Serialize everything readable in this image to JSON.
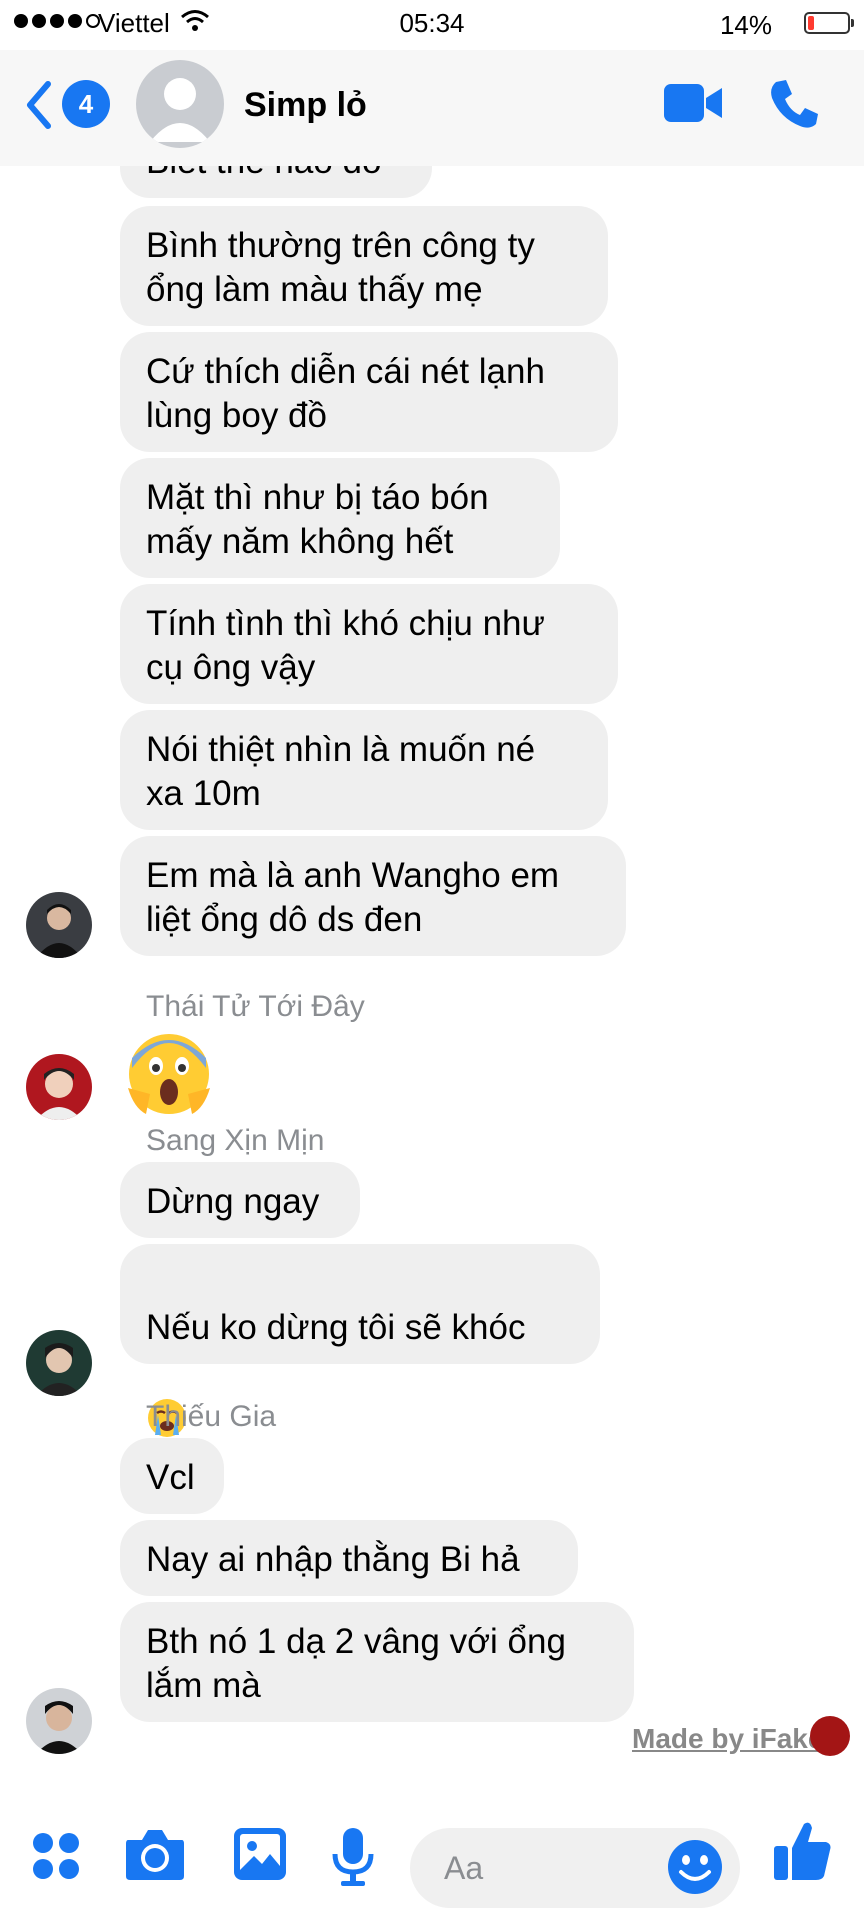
{
  "status_bar": {
    "carrier": "Viettel",
    "time": "05:34",
    "battery": "14%",
    "battery_level": 0.14
  },
  "header": {
    "back_count": "4",
    "title": "Simp lỏ",
    "icons": [
      "back-chevron-icon",
      "video-call-icon",
      "phone-call-icon"
    ]
  },
  "messages": {
    "partial_top": "Biết thế nào đó",
    "group1": [
      "Bình thường trên công ty\nổng làm màu thấy mẹ",
      "Cứ thích diễn cái nét lạnh\nlùng boy đồ",
      "Mặt thì như bị táo bón\nmấy năm không hết",
      "Tính tình thì khó chịu như\ncụ ông vậy",
      "Nói thiệt nhìn là muốn né\nxa 10m",
      "Em mà là anh Wangho em\nliệt ổng dô ds đen"
    ],
    "sender2": "Thái Tử Tới Đây",
    "emoji2": "scream-emoji",
    "sender3": "Sang Xịn Mịn",
    "group3": [
      "Dừng ngay",
      "Nếu ko dừng tôi sẽ khóc"
    ],
    "emoji3": "loudly-crying-emoji",
    "sender4": "Thiếu Gia",
    "group4": [
      "Vcl",
      "Nay ai nhập thằng Bi hả",
      "Bth nó 1 dạ 2 vâng với ổng\nlắm mà"
    ]
  },
  "watermark": "Made by iFake",
  "composer": {
    "placeholder": "Aa",
    "icons": [
      "menu-grid-icon",
      "camera-icon",
      "gallery-icon",
      "microphone-icon",
      "emoji-icon",
      "thumbs-up-icon"
    ]
  },
  "colors": {
    "accent": "#1877f2",
    "bubble": "#efefef",
    "sender_name": "#8a8d91",
    "header_bg": "#f7f7f7"
  }
}
